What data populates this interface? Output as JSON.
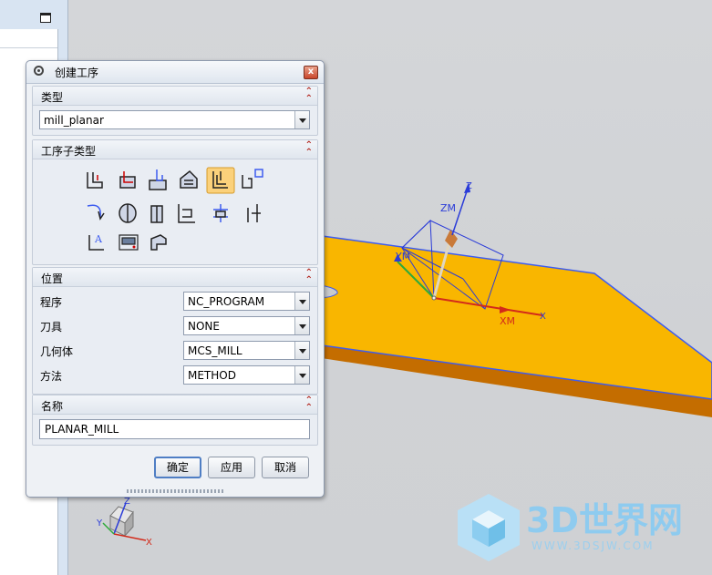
{
  "dialog": {
    "title": "创建工序",
    "close_label": "x",
    "sections": {
      "type": {
        "label": "类型",
        "value": "mill_planar"
      },
      "subtype": {
        "label": "工序子类型"
      },
      "location": {
        "label": "位置",
        "fields": [
          {
            "label": "程序",
            "value": "NC_PROGRAM"
          },
          {
            "label": "刀具",
            "value": "NONE"
          },
          {
            "label": "几何体",
            "value": "MCS_MILL"
          },
          {
            "label": "方法",
            "value": "METHOD"
          }
        ]
      },
      "name": {
        "label": "名称",
        "value": "PLANAR_MILL"
      }
    },
    "buttons": {
      "ok": "确定",
      "apply": "应用",
      "cancel": "取消"
    }
  },
  "viewport": {
    "axis_labels": {
      "zm": "ZM",
      "z": "Z",
      "ym": "YM",
      "xm": "XM",
      "x": "X",
      "y": "Y"
    },
    "colors": {
      "part_top": "#f9b600",
      "part_side": "#c46d00",
      "edge": "#3d5cf0",
      "background": "#d1d3d6"
    }
  },
  "watermark": {
    "title": "3D世界网",
    "url": "WWW.3DSJW.COM"
  }
}
